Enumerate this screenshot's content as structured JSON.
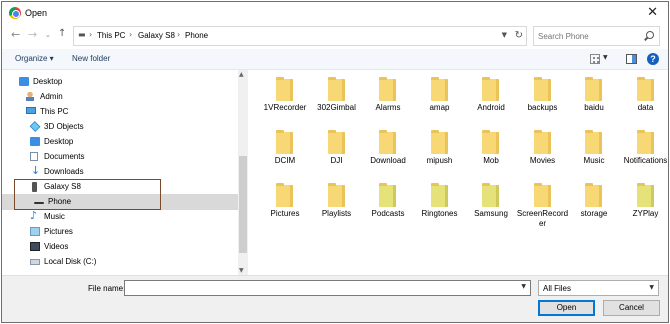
{
  "window": {
    "title": "Open"
  },
  "address": {
    "crumbs": [
      "This PC",
      "Galaxy S8",
      "Phone"
    ],
    "search_placeholder": "Search Phone"
  },
  "toolbar": {
    "organize": "Organize ▾",
    "new_folder": "New folder"
  },
  "nav_tree": [
    {
      "label": "Desktop",
      "icon": "desktop-icon"
    },
    {
      "label": "Admin",
      "icon": "user-icon"
    },
    {
      "label": "This PC",
      "icon": "pc-icon"
    },
    {
      "label": "3D Objects",
      "icon": "cube-icon"
    },
    {
      "label": "Desktop",
      "icon": "desktop-icon"
    },
    {
      "label": "Documents",
      "icon": "documents-icon"
    },
    {
      "label": "Downloads",
      "icon": "download-icon"
    },
    {
      "label": "Galaxy S8",
      "icon": "phone-icon"
    },
    {
      "label": "Phone",
      "icon": "phone-storage-icon",
      "selected": true
    },
    {
      "label": "Music",
      "icon": "music-icon"
    },
    {
      "label": "Pictures",
      "icon": "pictures-icon"
    },
    {
      "label": "Videos",
      "icon": "videos-icon"
    },
    {
      "label": "Local Disk (C:)",
      "icon": "disk-icon"
    }
  ],
  "files": [
    {
      "name": "1VRecorder"
    },
    {
      "name": "302Gimbal"
    },
    {
      "name": "Alarms"
    },
    {
      "name": "amap"
    },
    {
      "name": "Android"
    },
    {
      "name": "backups"
    },
    {
      "name": "baidu"
    },
    {
      "name": "data"
    },
    {
      "name": "DCIM"
    },
    {
      "name": "DJI"
    },
    {
      "name": "Download"
    },
    {
      "name": "mipush"
    },
    {
      "name": "Mob"
    },
    {
      "name": "Movies"
    },
    {
      "name": "Music"
    },
    {
      "name": "Notifications"
    },
    {
      "name": "Pictures"
    },
    {
      "name": "Playlists"
    },
    {
      "name": "Podcasts"
    },
    {
      "name": "Ringtones"
    },
    {
      "name": "Samsung"
    },
    {
      "name": "ScreenRecorder"
    },
    {
      "name": "storage"
    },
    {
      "name": "ZYPlay"
    }
  ],
  "footer": {
    "file_name_label": "File name:",
    "file_name_value": "",
    "file_type": "All Files",
    "open": "Open",
    "cancel": "Cancel"
  }
}
